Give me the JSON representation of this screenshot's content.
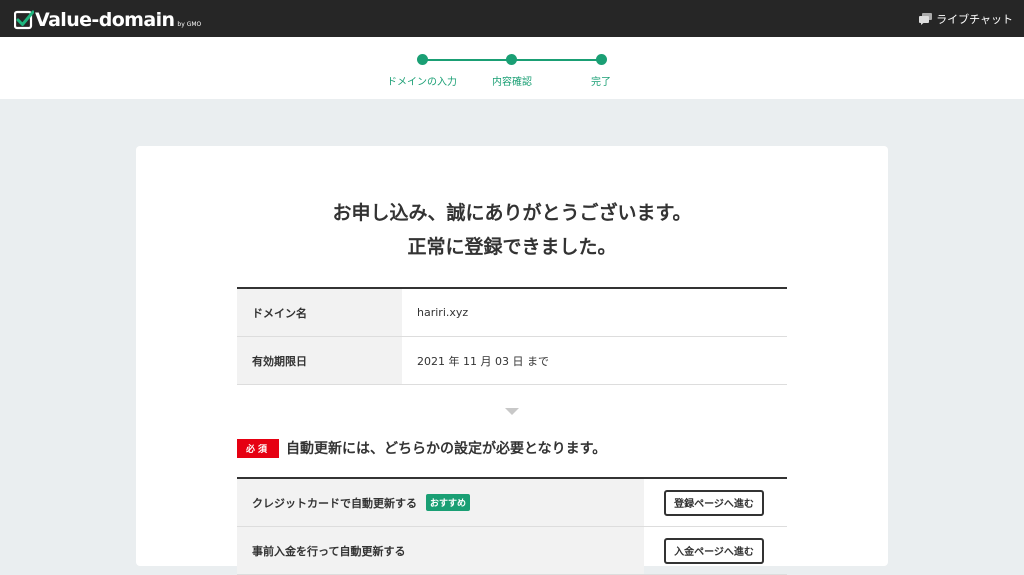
{
  "header": {
    "logo_text": "Value-domain",
    "logo_sub": "by GMO",
    "chat_label": "ライブチャット"
  },
  "progress": {
    "steps": [
      {
        "label": "ドメインの入力"
      },
      {
        "label": "内容確認"
      },
      {
        "label": "完了"
      }
    ],
    "color": "#1a9f74"
  },
  "main": {
    "headline_1": "お申し込み、誠にありがとうございます。",
    "headline_2": "正常に登録できました。",
    "info": [
      {
        "label": "ドメイン名",
        "value": "hariri.xyz"
      },
      {
        "label": "有効期限日",
        "value": "2021 年 11 月 03 日 まで"
      }
    ],
    "required_badge": "必須",
    "required_text": "自動更新には、どちらかの設定が必要となります。",
    "options": [
      {
        "label": "クレジットカードで自動更新する",
        "badge": "おすすめ",
        "button": "登録ページへ進む"
      },
      {
        "label": "事前入金を行って自動更新する",
        "button": "入金ページへ進む"
      }
    ]
  },
  "colors": {
    "header_bg": "#262626",
    "accent": "#1a9f74",
    "required": "#e60012",
    "page_bg": "#eaeef0"
  }
}
